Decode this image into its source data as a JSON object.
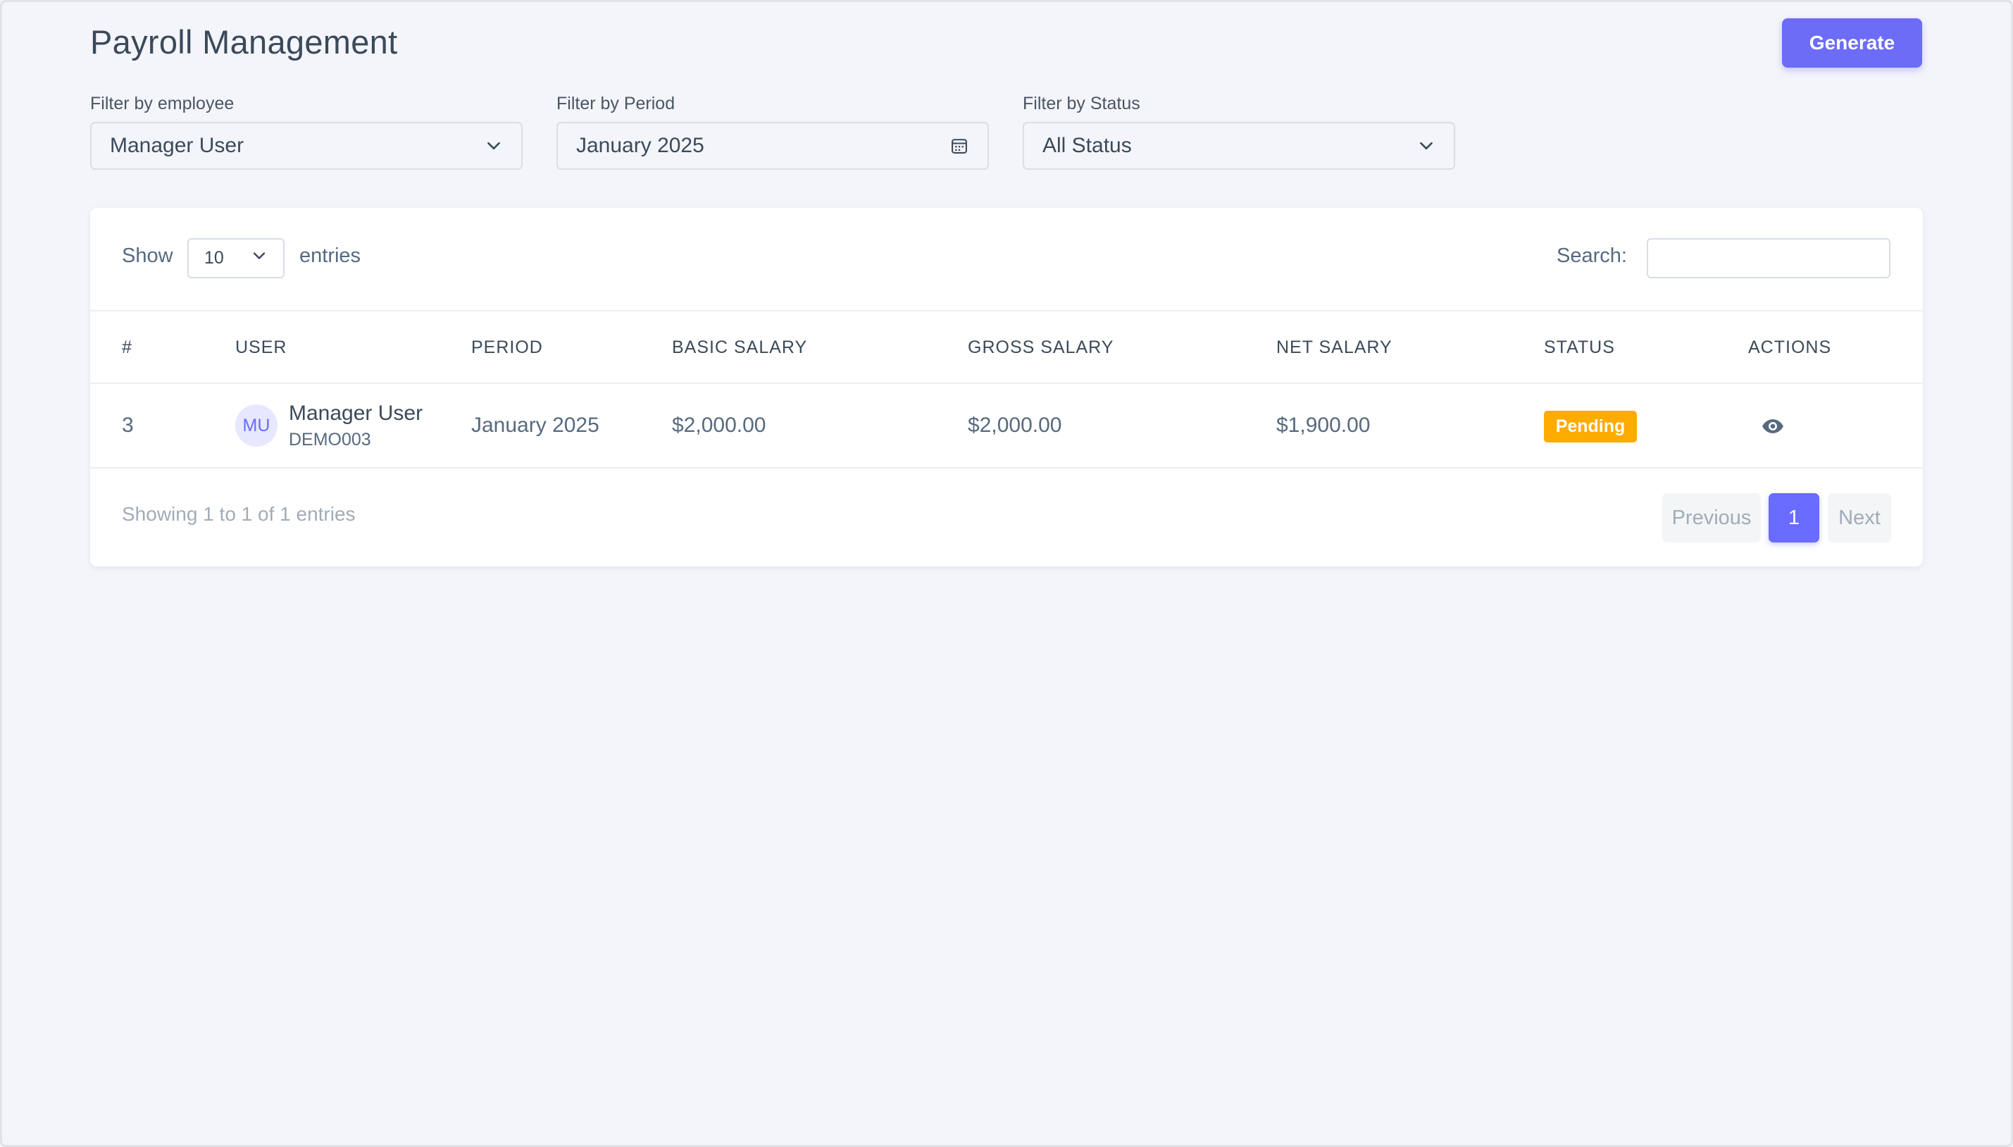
{
  "page": {
    "title": "Payroll Management",
    "generate_label": "Generate"
  },
  "filters": {
    "employee": {
      "label": "Filter by employee",
      "value": "Manager User",
      "icon": "chevron-down-icon"
    },
    "period": {
      "label": "Filter by Period",
      "value": "January 2025",
      "icon": "calendar-icon"
    },
    "status": {
      "label": "Filter by Status",
      "value": "All Status",
      "icon": "chevron-down-icon"
    }
  },
  "table_controls": {
    "show_label": "Show",
    "length_value": "10",
    "entries_label": "entries",
    "search_label": "Search:",
    "search_value": ""
  },
  "table": {
    "columns": [
      "#",
      "USER",
      "PERIOD",
      "BASIC SALARY",
      "GROSS SALARY",
      "NET SALARY",
      "STATUS",
      "ACTIONS"
    ],
    "rows": [
      {
        "id": "3",
        "initials": "MU",
        "name": "Manager User",
        "code": "DEMO003",
        "period": "January 2025",
        "basic_salary": "$2,000.00",
        "gross_salary": "$2,000.00",
        "net_salary": "$1,900.00",
        "status": "Pending",
        "action_icon": "eye-icon"
      }
    ]
  },
  "footer": {
    "showing": "Showing 1 to 1 of 1 entries",
    "previous": "Previous",
    "current_page": "1",
    "next": "Next"
  },
  "colors": {
    "accent": "#696cff",
    "pending": "#ffab00",
    "background": "#f4f5fa"
  }
}
